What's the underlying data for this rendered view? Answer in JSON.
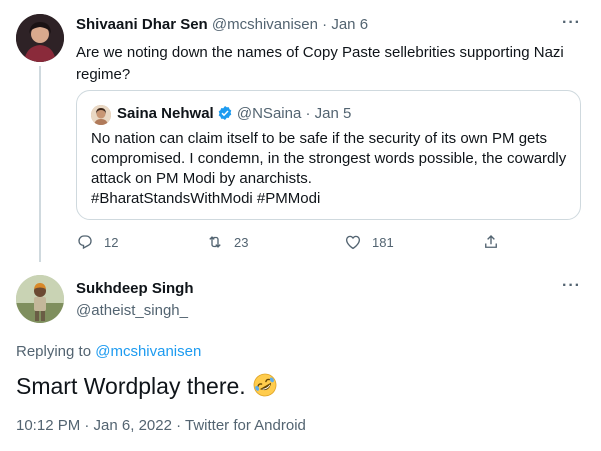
{
  "parent_tweet": {
    "author_name": "Shivaani Dhar Sen",
    "handle": "@mcshivanisen",
    "separator": "·",
    "date": "Jan 6",
    "text": "Are we noting down the names of Copy Paste sellebrities supporting Nazi regime?",
    "quoted_tweet": {
      "author_name": "Saina Nehwal",
      "verified": true,
      "handle": "@NSaina",
      "separator": "·",
      "date": "Jan 5",
      "text_lines": [
        "No nation can claim itself to be safe if the security of its own PM gets",
        "compromised. I condemn, in the strongest words possible, the cowardly",
        "attack on PM Modi by anarchists.",
        "#BharatStandsWithModi #PMModi"
      ]
    },
    "actions": {
      "reply_count": "12",
      "retweet_count": "23",
      "like_count": "181"
    }
  },
  "main_tweet": {
    "author_name": "Sukhdeep Singh",
    "handle": "@atheist_singh_",
    "replying_prefix": "Replying to",
    "replying_to": "@mcshivanisen",
    "text": "Smart Wordplay there.",
    "emoji": "rolling-on-floor-laughing-emoji",
    "timestamp": "10:12 PM · Jan 6, 2022 · Twitter for Android"
  },
  "colors": {
    "accent": "#1d9bf0",
    "muted": "#536471",
    "text": "#0f1419",
    "border": "#cfd9de"
  }
}
